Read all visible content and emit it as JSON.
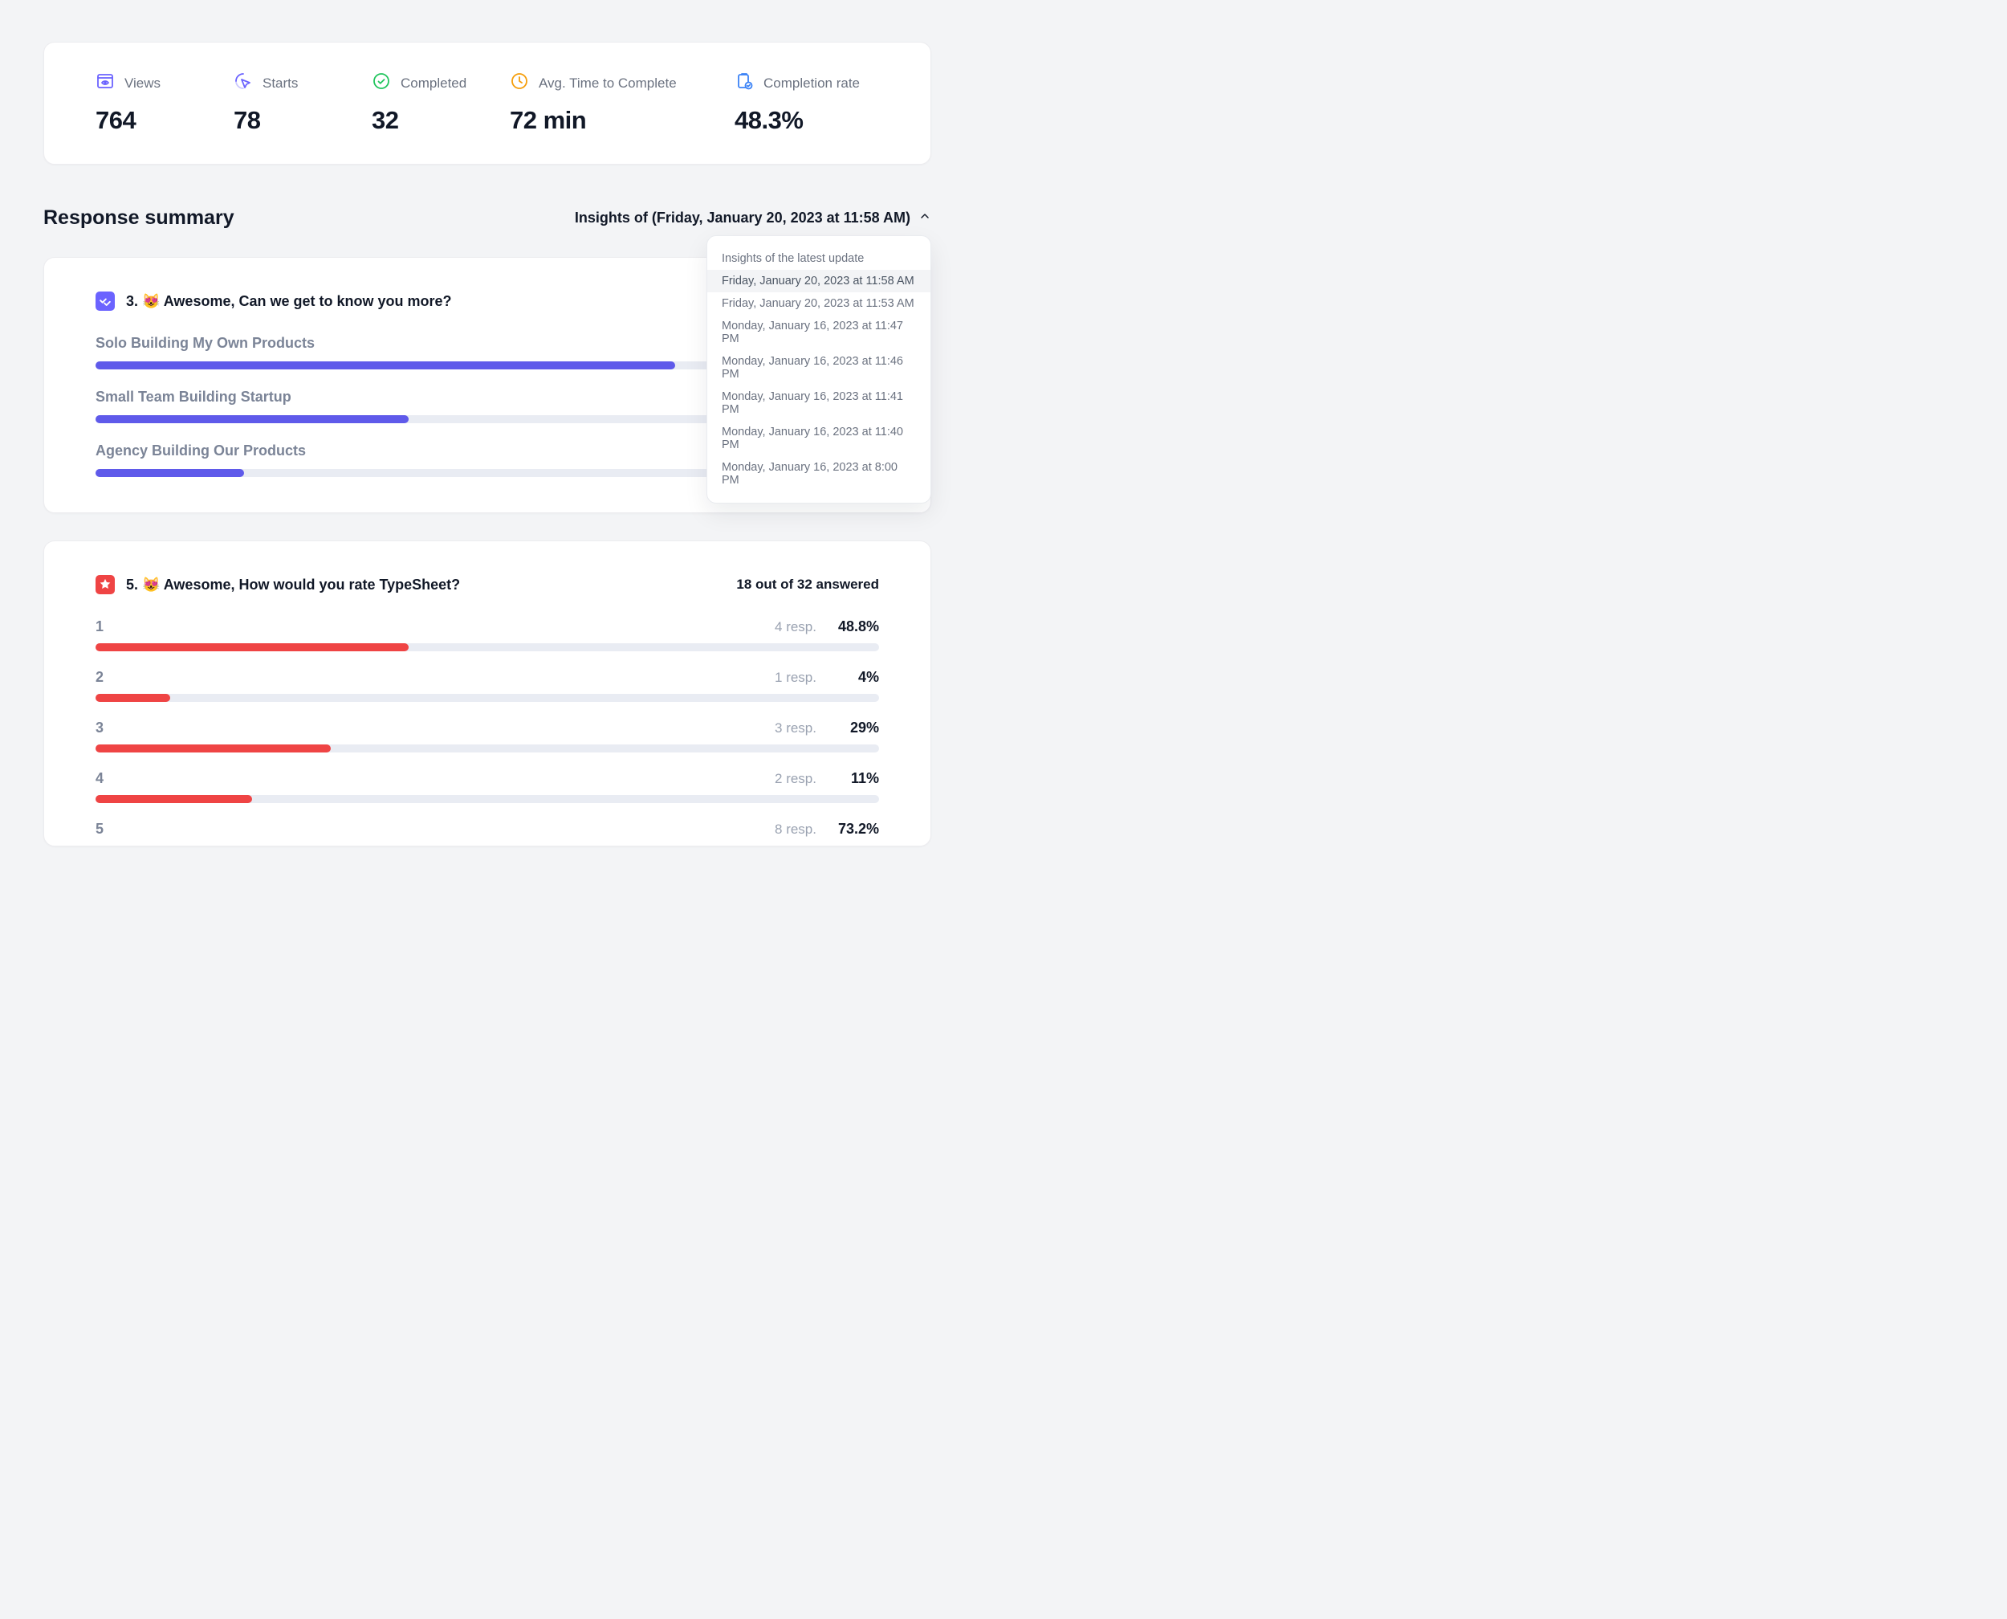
{
  "stats": {
    "views": {
      "label": "Views",
      "value": "764"
    },
    "starts": {
      "label": "Starts",
      "value": "78"
    },
    "completed": {
      "label": "Completed",
      "value": "32"
    },
    "avg_time": {
      "label": "Avg. Time to Complete",
      "value": "72 min"
    },
    "completion": {
      "label": "Completion rate",
      "value": "48.3%"
    }
  },
  "section_title": "Response summary",
  "insights": {
    "label": "Insights of (Friday, January 20, 2023 at 11:58 AM)",
    "options": [
      "Insights of the latest update",
      "Friday, January 20, 2023 at 11:58 AM",
      "Friday, January 20, 2023 at 11:53 AM",
      "Monday, January 16, 2023 at 11:47 PM",
      "Monday, January 16, 2023 at 11:46 PM",
      "Monday, January 16, 2023 at 11:41 PM",
      "Monday, January 16, 2023 at 11:40 PM",
      "Monday, January 16, 2023 at 8:00 PM"
    ],
    "selected_index": 1
  },
  "q3": {
    "title": "3. 😻 Awesome, Can we get to know you more?",
    "options": [
      {
        "label": "Solo Building My Own Products",
        "pct": 74
      },
      {
        "label": "Small Team Building Startup",
        "pct": 40
      },
      {
        "label": "Agency Building Our Products",
        "pct": 19
      }
    ]
  },
  "q5": {
    "title": "5. 😻 Awesome, How would you rate TypeSheet?",
    "answered": "18 out of 32 answered",
    "ratings": [
      {
        "num": "1",
        "resp": "4 resp.",
        "pct_label": "48.8%",
        "bar": 40
      },
      {
        "num": "2",
        "resp": "1 resp.",
        "pct_label": "4%",
        "bar": 9.5
      },
      {
        "num": "3",
        "resp": "3 resp.",
        "pct_label": "29%",
        "bar": 30
      },
      {
        "num": "4",
        "resp": "2 resp.",
        "pct_label": "11%",
        "bar": 20
      },
      {
        "num": "5",
        "resp": "8 resp.",
        "pct_label": "73.2%",
        "bar": 0
      }
    ]
  },
  "colors": {
    "indigo": "#6b63ff",
    "purple_bar": "#5f5aea",
    "red": "#ef4444",
    "green": "#22c55e",
    "amber": "#f59e0b",
    "blue": "#3b82f6"
  }
}
